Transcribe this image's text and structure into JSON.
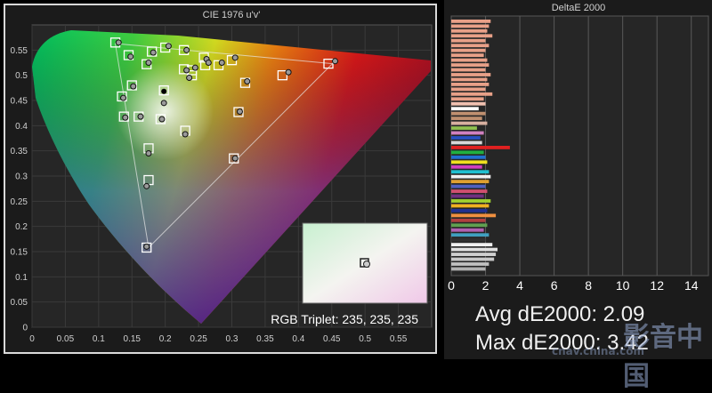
{
  "left_panel": {
    "title": "CIE 1976 u'v'",
    "triplet_text": "RGB Triplet: 235, 235, 235"
  },
  "right_panel": {
    "title": "DeltaE 2000"
  },
  "summary": {
    "avg_text": "Avg dE2000: 2.09",
    "max_text": "Max dE2000: 3.42"
  },
  "watermark": {
    "main": "影音中国",
    "url": "cnav.china.com"
  },
  "chart_data": [
    {
      "type": "scatter",
      "title": "CIE 1976 u'v'",
      "xlim": [
        0,
        0.6
      ],
      "ylim": [
        0,
        0.6
      ],
      "xticks": [
        "0",
        "0.05",
        "0.1",
        "0.15",
        "0.2",
        "0.25",
        "0.3",
        "0.35",
        "0.4",
        "0.45",
        "0.5",
        "0.55"
      ],
      "yticks": [
        "0.55",
        "0.5",
        "0.45",
        "0.4",
        "0.35",
        "0.3",
        "0.25",
        "0.2",
        "0.15",
        "0.1",
        "0.05",
        "0"
      ],
      "gamut_triangle": [
        [
          0.451,
          0.523
        ],
        [
          0.125,
          0.563
        ],
        [
          0.175,
          0.158
        ]
      ],
      "white_point": [
        0.198,
        0.468
      ],
      "targets": [
        [
          0.125,
          0.565
        ],
        [
          0.145,
          0.54
        ],
        [
          0.18,
          0.547
        ],
        [
          0.2,
          0.555
        ],
        [
          0.228,
          0.55
        ],
        [
          0.258,
          0.535
        ],
        [
          0.172,
          0.522
        ],
        [
          0.228,
          0.512
        ],
        [
          0.24,
          0.51
        ],
        [
          0.26,
          0.52
        ],
        [
          0.28,
          0.52
        ],
        [
          0.3,
          0.53
        ],
        [
          0.24,
          0.5
        ],
        [
          0.15,
          0.48
        ],
        [
          0.135,
          0.458
        ],
        [
          0.198,
          0.47
        ],
        [
          0.138,
          0.418
        ],
        [
          0.16,
          0.418
        ],
        [
          0.193,
          0.413
        ],
        [
          0.23,
          0.39
        ],
        [
          0.31,
          0.427
        ],
        [
          0.32,
          0.485
        ],
        [
          0.376,
          0.5
        ],
        [
          0.445,
          0.523
        ],
        [
          0.303,
          0.335
        ],
        [
          0.175,
          0.355
        ],
        [
          0.175,
          0.292
        ],
        [
          0.172,
          0.158
        ]
      ],
      "measured": [
        [
          0.13,
          0.565
        ],
        [
          0.148,
          0.537
        ],
        [
          0.182,
          0.545
        ],
        [
          0.205,
          0.558
        ],
        [
          0.232,
          0.55
        ],
        [
          0.262,
          0.532
        ],
        [
          0.175,
          0.525
        ],
        [
          0.232,
          0.51
        ],
        [
          0.245,
          0.515
        ],
        [
          0.265,
          0.525
        ],
        [
          0.285,
          0.525
        ],
        [
          0.305,
          0.535
        ],
        [
          0.236,
          0.495
        ],
        [
          0.152,
          0.478
        ],
        [
          0.137,
          0.455
        ],
        [
          0.198,
          0.445
        ],
        [
          0.14,
          0.416
        ],
        [
          0.163,
          0.418
        ],
        [
          0.195,
          0.413
        ],
        [
          0.23,
          0.383
        ],
        [
          0.312,
          0.428
        ],
        [
          0.323,
          0.488
        ],
        [
          0.385,
          0.506
        ],
        [
          0.455,
          0.528
        ],
        [
          0.305,
          0.335
        ],
        [
          0.175,
          0.345
        ],
        [
          0.172,
          0.28
        ],
        [
          0.172,
          0.16
        ]
      ]
    },
    {
      "type": "bar",
      "orientation": "horizontal",
      "title": "DeltaE 2000",
      "xlim": [
        0,
        15
      ],
      "xticks": [
        "0",
        "2",
        "4",
        "6",
        "8",
        "10",
        "12",
        "14"
      ],
      "bars": [
        {
          "value": 2.3,
          "color": "#e8a088"
        },
        {
          "value": 2.2,
          "color": "#e8a088"
        },
        {
          "value": 2.1,
          "color": "#e8a088"
        },
        {
          "value": 2.4,
          "color": "#e8a088"
        },
        {
          "value": 2.0,
          "color": "#e8a088"
        },
        {
          "value": 2.2,
          "color": "#e8a088"
        },
        {
          "value": 2.0,
          "color": "#e8a088"
        },
        {
          "value": 1.9,
          "color": "#e8a088"
        },
        {
          "value": 2.1,
          "color": "#e8a088"
        },
        {
          "value": 2.2,
          "color": "#e8a088"
        },
        {
          "value": 2.0,
          "color": "#e8a088"
        },
        {
          "value": 2.3,
          "color": "#e8a088"
        },
        {
          "value": 2.1,
          "color": "#e8a088"
        },
        {
          "value": 2.2,
          "color": "#e8a088"
        },
        {
          "value": 2.0,
          "color": "#e8a088"
        },
        {
          "value": 2.4,
          "color": "#e8a088"
        },
        {
          "value": 1.9,
          "color": "#e8a088"
        },
        {
          "value": 2.0,
          "color": "#f0c0b0"
        },
        {
          "value": 1.6,
          "color": "#ffffff"
        },
        {
          "value": 2.0,
          "color": "#c09070"
        },
        {
          "value": 1.8,
          "color": "#c09070"
        },
        {
          "value": 2.1,
          "color": "#d8b0a0"
        },
        {
          "value": 1.5,
          "color": "#90c050"
        },
        {
          "value": 1.9,
          "color": "#d080c0"
        },
        {
          "value": 1.7,
          "color": "#2850c0"
        },
        {
          "value": 1.8,
          "color": "#d8d8d8"
        },
        {
          "value": 3.42,
          "color": "#e02020"
        },
        {
          "value": 1.9,
          "color": "#20b040"
        },
        {
          "value": 2.0,
          "color": "#2070d0"
        },
        {
          "value": 2.1,
          "color": "#f0e020"
        },
        {
          "value": 1.8,
          "color": "#d040c0"
        },
        {
          "value": 2.2,
          "color": "#20c0d0"
        },
        {
          "value": 2.3,
          "color": "#f0f0f0"
        },
        {
          "value": 2.2,
          "color": "#e0a030"
        },
        {
          "value": 2.0,
          "color": "#5060c0"
        },
        {
          "value": 2.1,
          "color": "#d05070"
        },
        {
          "value": 1.9,
          "color": "#703080"
        },
        {
          "value": 2.3,
          "color": "#a0d030"
        },
        {
          "value": 2.2,
          "color": "#f0b020"
        },
        {
          "value": 2.1,
          "color": "#203090"
        },
        {
          "value": 2.6,
          "color": "#f09040"
        },
        {
          "value": 2.0,
          "color": "#b04040"
        },
        {
          "value": 2.1,
          "color": "#60a050"
        },
        {
          "value": 1.9,
          "color": "#b060b0"
        },
        {
          "value": 2.2,
          "color": "#40a0c0"
        },
        {
          "value": 2.0,
          "color": "#303030"
        },
        {
          "value": 2.4,
          "color": "#f0f0f0"
        },
        {
          "value": 2.7,
          "color": "#e0e0e0"
        },
        {
          "value": 2.6,
          "color": "#d0d0d0"
        },
        {
          "value": 2.5,
          "color": "#c8c8c8"
        },
        {
          "value": 2.2,
          "color": "#c0c0c0"
        },
        {
          "value": 2.0,
          "color": "#b0b0b0"
        }
      ]
    }
  ]
}
